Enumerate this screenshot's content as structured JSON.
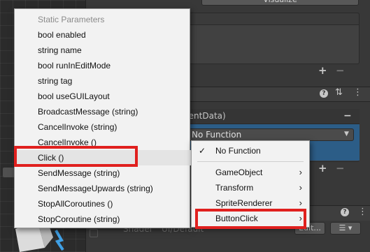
{
  "inspector": {
    "visualize_label": "Visualize",
    "event_header_text": "rentData)",
    "function_dropdown_value": "No Function",
    "shader_label": "Shader",
    "shader_value": "UI/Default",
    "edit_label": "Edit...",
    "list_label": "☰ ▾"
  },
  "context_menu": {
    "items": [
      {
        "label": "Static Parameters",
        "disabled": true
      },
      {
        "label": "bool enabled"
      },
      {
        "label": "string name"
      },
      {
        "label": "bool runInEditMode"
      },
      {
        "label": "string tag"
      },
      {
        "label": "bool useGUILayout"
      },
      {
        "label": "BroadcastMessage (string)"
      },
      {
        "label": "CancelInvoke (string)"
      },
      {
        "label": "CancelInvoke ()"
      },
      {
        "label": "Click ()",
        "highlighted": true
      },
      {
        "label": "SendMessage (string)"
      },
      {
        "label": "SendMessageUpwards (string)"
      },
      {
        "label": "StopAllCoroutines ()"
      },
      {
        "label": "StopCoroutine (string)"
      }
    ]
  },
  "sub_menu": {
    "items": [
      {
        "label": "No Function",
        "checked": true
      },
      {
        "label": "GameObject",
        "has_submenu": true
      },
      {
        "label": "Transform",
        "has_submenu": true
      },
      {
        "label": "SpriteRenderer",
        "has_submenu": true
      },
      {
        "label": "ButtonClick",
        "has_submenu": true
      }
    ]
  },
  "colors": {
    "highlight_box": "#e0201e",
    "selected_row": "#2c5d87",
    "menu_bg": "#f2f2f2"
  }
}
